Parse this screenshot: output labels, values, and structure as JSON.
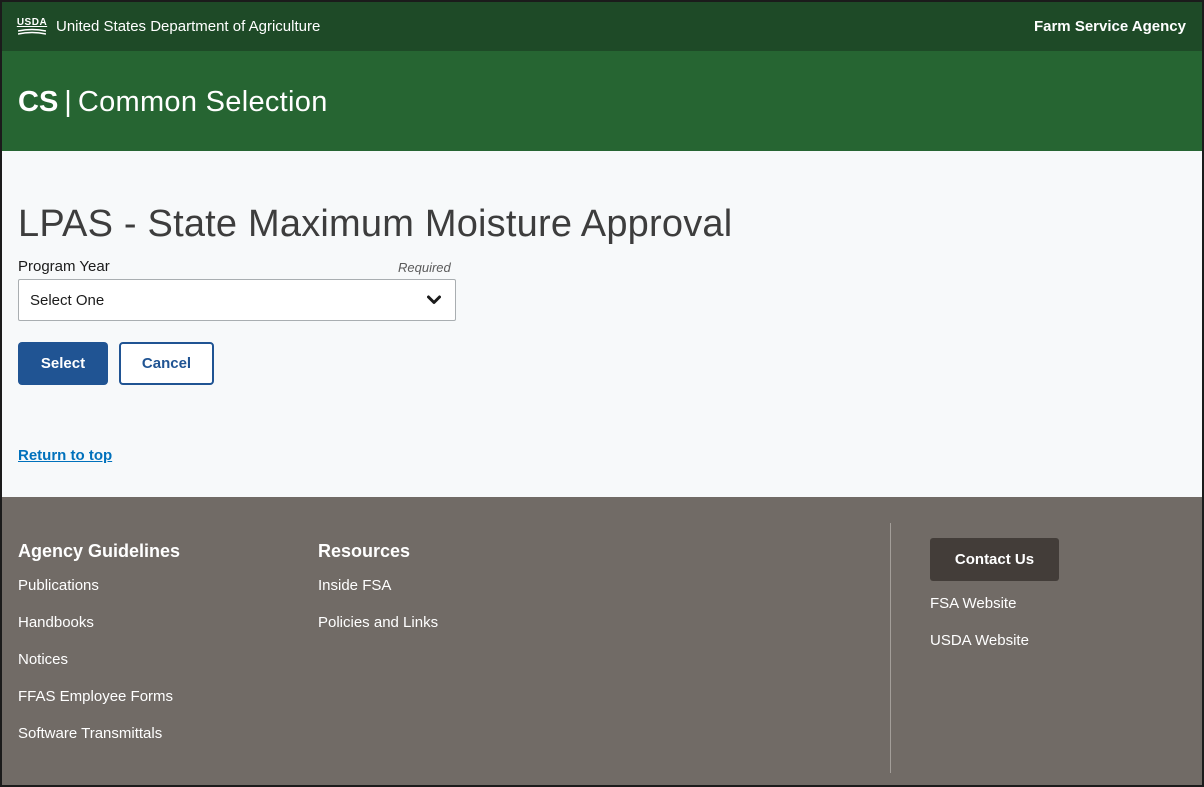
{
  "usda_bar": {
    "logo_text": "USDA",
    "department": "United States Department of Agriculture",
    "agency": "Farm Service Agency"
  },
  "app_header": {
    "abbr": "CS",
    "separator": "|",
    "name": "Common Selection"
  },
  "main": {
    "title": "LPAS - State Maximum Moisture Approval",
    "program_year": {
      "label": "Program Year",
      "required_text": "Required",
      "selected": "Select One"
    },
    "select_button": "Select",
    "cancel_button": "Cancel",
    "return_to_top": "Return to top"
  },
  "footer": {
    "agency_guidelines": {
      "title": "Agency Guidelines",
      "links": [
        "Publications",
        "Handbooks",
        "Notices",
        "FFAS Employee Forms",
        "Software Transmittals"
      ]
    },
    "resources": {
      "title": "Resources",
      "links": [
        "Inside FSA",
        "Policies and Links"
      ]
    },
    "contact": {
      "button": "Contact Us",
      "links": [
        "FSA Website",
        "USDA Website"
      ]
    }
  },
  "colors": {
    "usda_bar": "#1e4a27",
    "app_header": "#266532",
    "main_bg": "#f7f9fa",
    "primary_button": "#205493",
    "link": "#0071bc",
    "footer_bg": "#716b66",
    "contact_button": "#433d39"
  }
}
